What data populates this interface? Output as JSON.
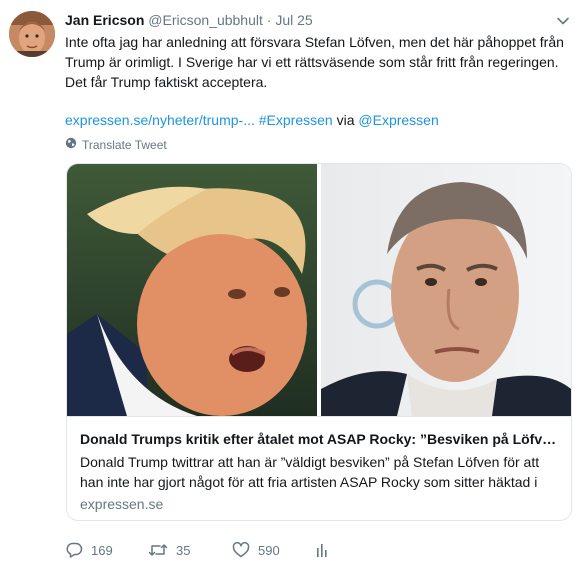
{
  "tweet": {
    "author_name": "Jan Ericson",
    "author_handle": "@Ericson_ubbhult",
    "separator": "·",
    "date": "Jul 25",
    "text_line1": "Inte ofta jag har anledning att försvara Stefan Löfven, men det här påhoppet från",
    "text_line2": "Trump är orimligt. I Sverige har vi ett rättsväsende som står fritt från regeringen.",
    "text_line3": "Det får Trump faktiskt acceptera.",
    "link_url": "expressen.se/nyheter/trump-...",
    "hashtag": "#Expressen",
    "via": "via",
    "mention": "@Expressen",
    "translate_label": "Translate Tweet"
  },
  "card": {
    "title": "Donald Trumps kritik efter åtalet mot ASAP Rocky: ”Besviken på Löfven”",
    "description": "Donald Trump twittrar att han är ”väldigt besviken” på Stefan Löfven för att han inte har gjort något för att fria artisten ASAP Rocky som sitter häktad i Sverige.",
    "domain": "expressen.se"
  },
  "actions": {
    "replies": "169",
    "retweets": "35",
    "likes": "590"
  },
  "icons": {
    "caret": "chevron-down-icon",
    "translate": "globe-icon",
    "reply": "reply-icon",
    "retweet": "retweet-icon",
    "like": "heart-icon",
    "analytics": "analytics-icon"
  },
  "colors": {
    "link": "#1b95e0",
    "secondary_text": "#657786",
    "border": "#e1e8ed"
  }
}
